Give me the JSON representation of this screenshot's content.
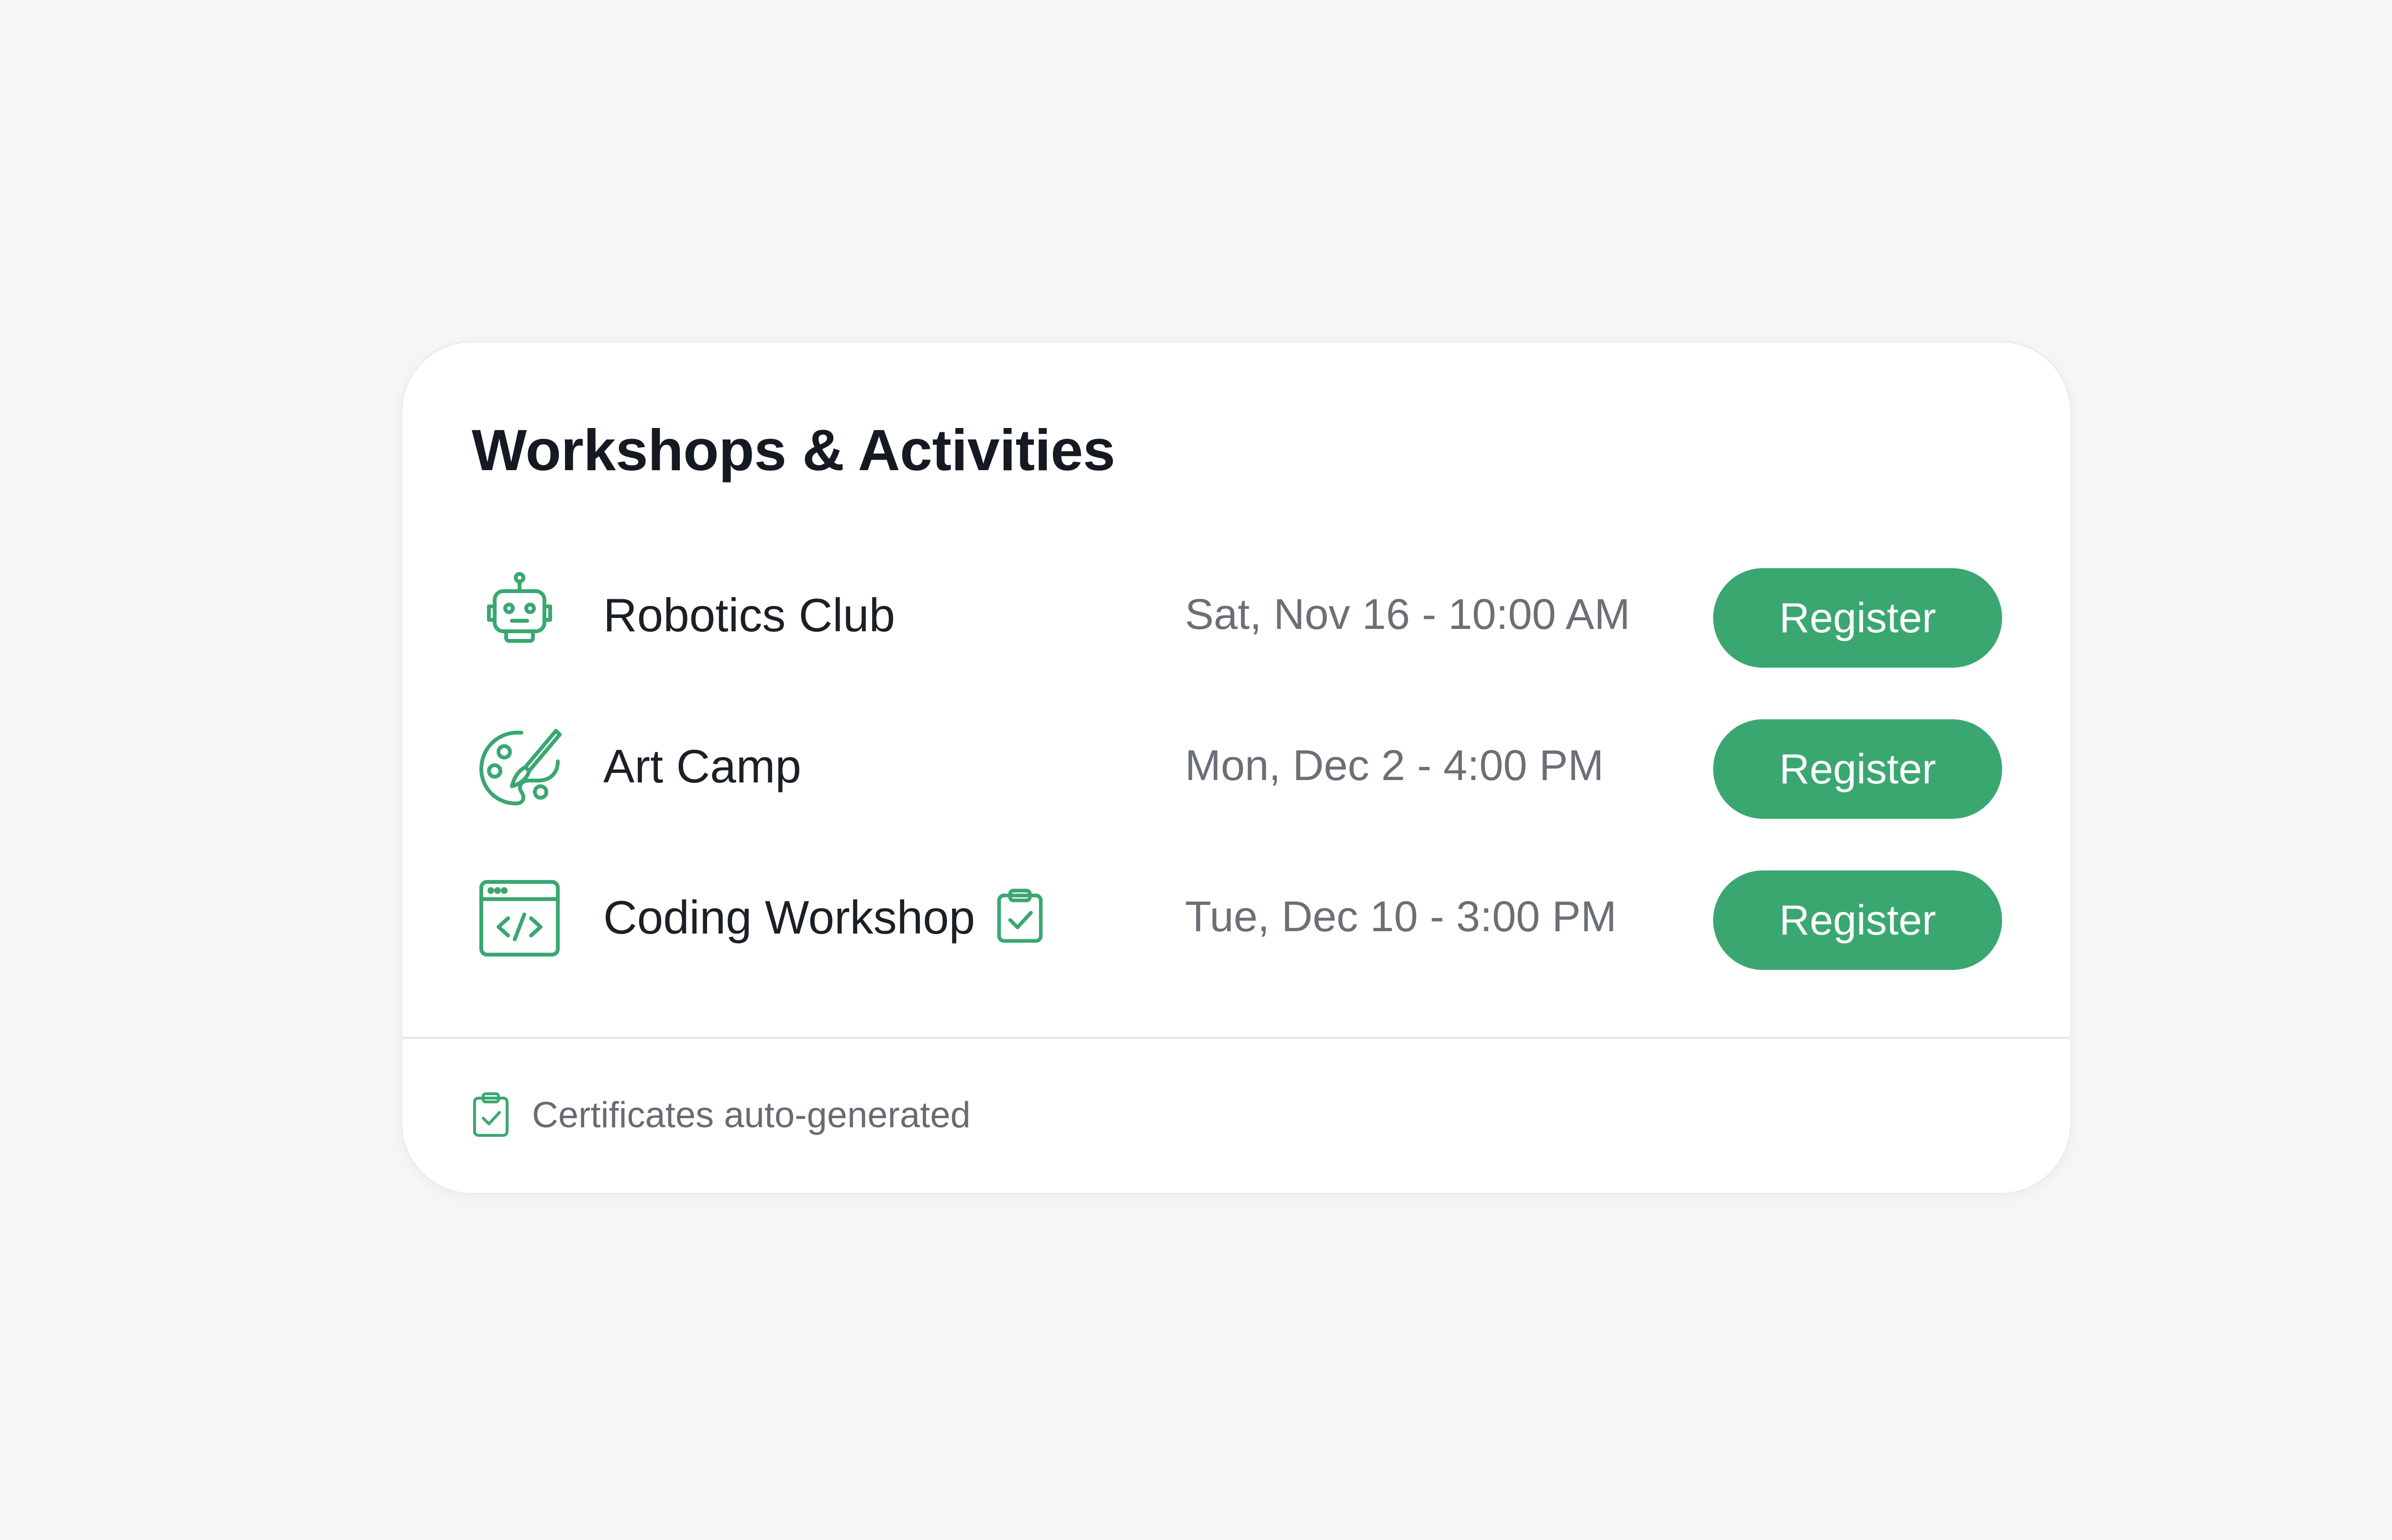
{
  "card": {
    "title": "Workshops & Activities"
  },
  "activities": [
    {
      "name": "Robotics Club",
      "icon": "robot-icon",
      "date": "Sat, Nov 16 - 10:00 AM",
      "button_label": "Register",
      "certificate_badge": false
    },
    {
      "name": "Art Camp",
      "icon": "palette-icon",
      "date": "Mon, Dec 2 - 4:00 PM",
      "button_label": "Register",
      "certificate_badge": false
    },
    {
      "name": "Coding Workshop",
      "icon": "code-window-icon",
      "date": "Tue, Dec 10 - 3:00 PM",
      "button_label": "Register",
      "certificate_badge": true
    }
  ],
  "footer": {
    "icon": "clipboard-check-icon",
    "text": "Certificates auto-generated"
  },
  "colors": {
    "accent": "#3aa771",
    "background": "#f6f6f6",
    "card": "#ffffff",
    "title_text": "#151a22",
    "muted_text": "#6b6f76"
  }
}
